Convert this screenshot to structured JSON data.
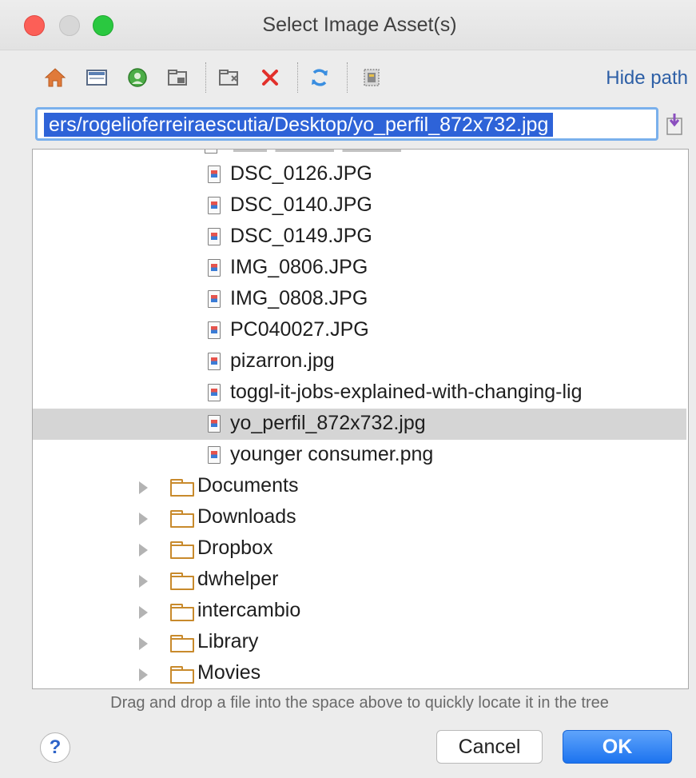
{
  "window": {
    "title": "Select Image Asset(s)"
  },
  "toolbar": {
    "icons": [
      "home-icon",
      "desktop-icon",
      "project-icon",
      "module-icon",
      "new-folder-icon",
      "delete-icon",
      "refresh-icon",
      "show-hidden-icon"
    ],
    "hide_path_label": "Hide path"
  },
  "path": {
    "value": "ers/rogelioferreiraescutia/Desktop/yo_perfil_872x732.jpg"
  },
  "tree": {
    "files": [
      {
        "name": "DSC_0126.JPG",
        "selected": false
      },
      {
        "name": "DSC_0140.JPG",
        "selected": false
      },
      {
        "name": "DSC_0149.JPG",
        "selected": false
      },
      {
        "name": "IMG_0806.JPG",
        "selected": false
      },
      {
        "name": "IMG_0808.JPG",
        "selected": false
      },
      {
        "name": "PC040027.JPG",
        "selected": false
      },
      {
        "name": "pizarron.jpg",
        "selected": false
      },
      {
        "name": "toggl-it-jobs-explained-with-changing-lig",
        "selected": false
      },
      {
        "name": "yo_perfil_872x732.jpg",
        "selected": true
      },
      {
        "name": "younger consumer.png",
        "selected": false
      }
    ],
    "folders": [
      "Documents",
      "Downloads",
      "Dropbox",
      "dwhelper",
      "intercambio",
      "Library",
      "Movies"
    ]
  },
  "hint": "Drag and drop a file into the space above to quickly locate it in the tree",
  "buttons": {
    "help": "?",
    "cancel": "Cancel",
    "ok": "OK"
  },
  "colors": {
    "accent": "#2e63d8",
    "link": "#2d5fa6",
    "ok_button": "#1c73ef",
    "folder": "#c88a2c"
  }
}
